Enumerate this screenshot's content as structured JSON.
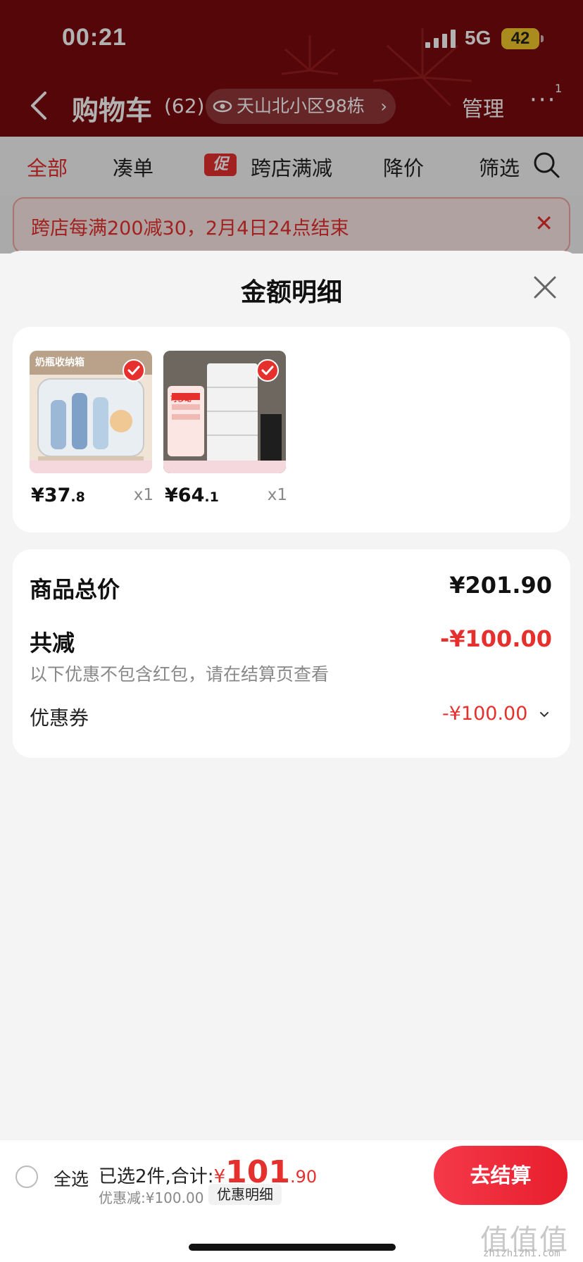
{
  "status_bar": {
    "time": "00:21",
    "network": "5G",
    "battery": "42"
  },
  "header": {
    "title": "购物车",
    "count": "(62)",
    "address": "天山北小区98栋",
    "manage": "管理",
    "more": "···",
    "more_badge": "1"
  },
  "filters": {
    "tabs": [
      "全部",
      "凑单",
      "跨店满减",
      "降价",
      "筛选"
    ],
    "promo_tag": "促"
  },
  "promo_banner": {
    "text": "跨店每满200减30，2月4日24点结束",
    "close": "✕"
  },
  "sheet": {
    "title": "金额明细",
    "products": [
      {
        "price_int": "¥37",
        "price_dec": ".8",
        "qty": "x1",
        "image_text": "奶瓶收纳箱"
      },
      {
        "price_int": "¥64",
        "price_dec": ".1",
        "qty": "x1",
        "image_text": "可移动"
      }
    ],
    "summary": {
      "total_label": "商品总价",
      "total_value": "¥201.90",
      "discount_label": "共减",
      "discount_value": "-¥100.00",
      "note": "以下优惠不包含红包，请在结算页查看",
      "coupon_label": "优惠券",
      "coupon_value": "-¥100.00"
    }
  },
  "checkout": {
    "select_all": "全选",
    "selected_text": "已选2件,合计:",
    "yen": "¥",
    "total_int": "101",
    "total_dec": ".90",
    "discount": "优惠减:¥100.00",
    "detail": "优惠明细",
    "button": "去结算"
  },
  "watermark": {
    "logo": "值值值",
    "text": "zhizhizhi.com"
  },
  "colors": {
    "accent": "#e5302d",
    "header_bg": "#7a0a0c",
    "checkout_btn": "#ee2b3a"
  },
  "icons": [
    "back-icon",
    "eye-icon",
    "search-icon",
    "close-icon",
    "check-icon",
    "chevron-down-icon",
    "signal-icon"
  ]
}
